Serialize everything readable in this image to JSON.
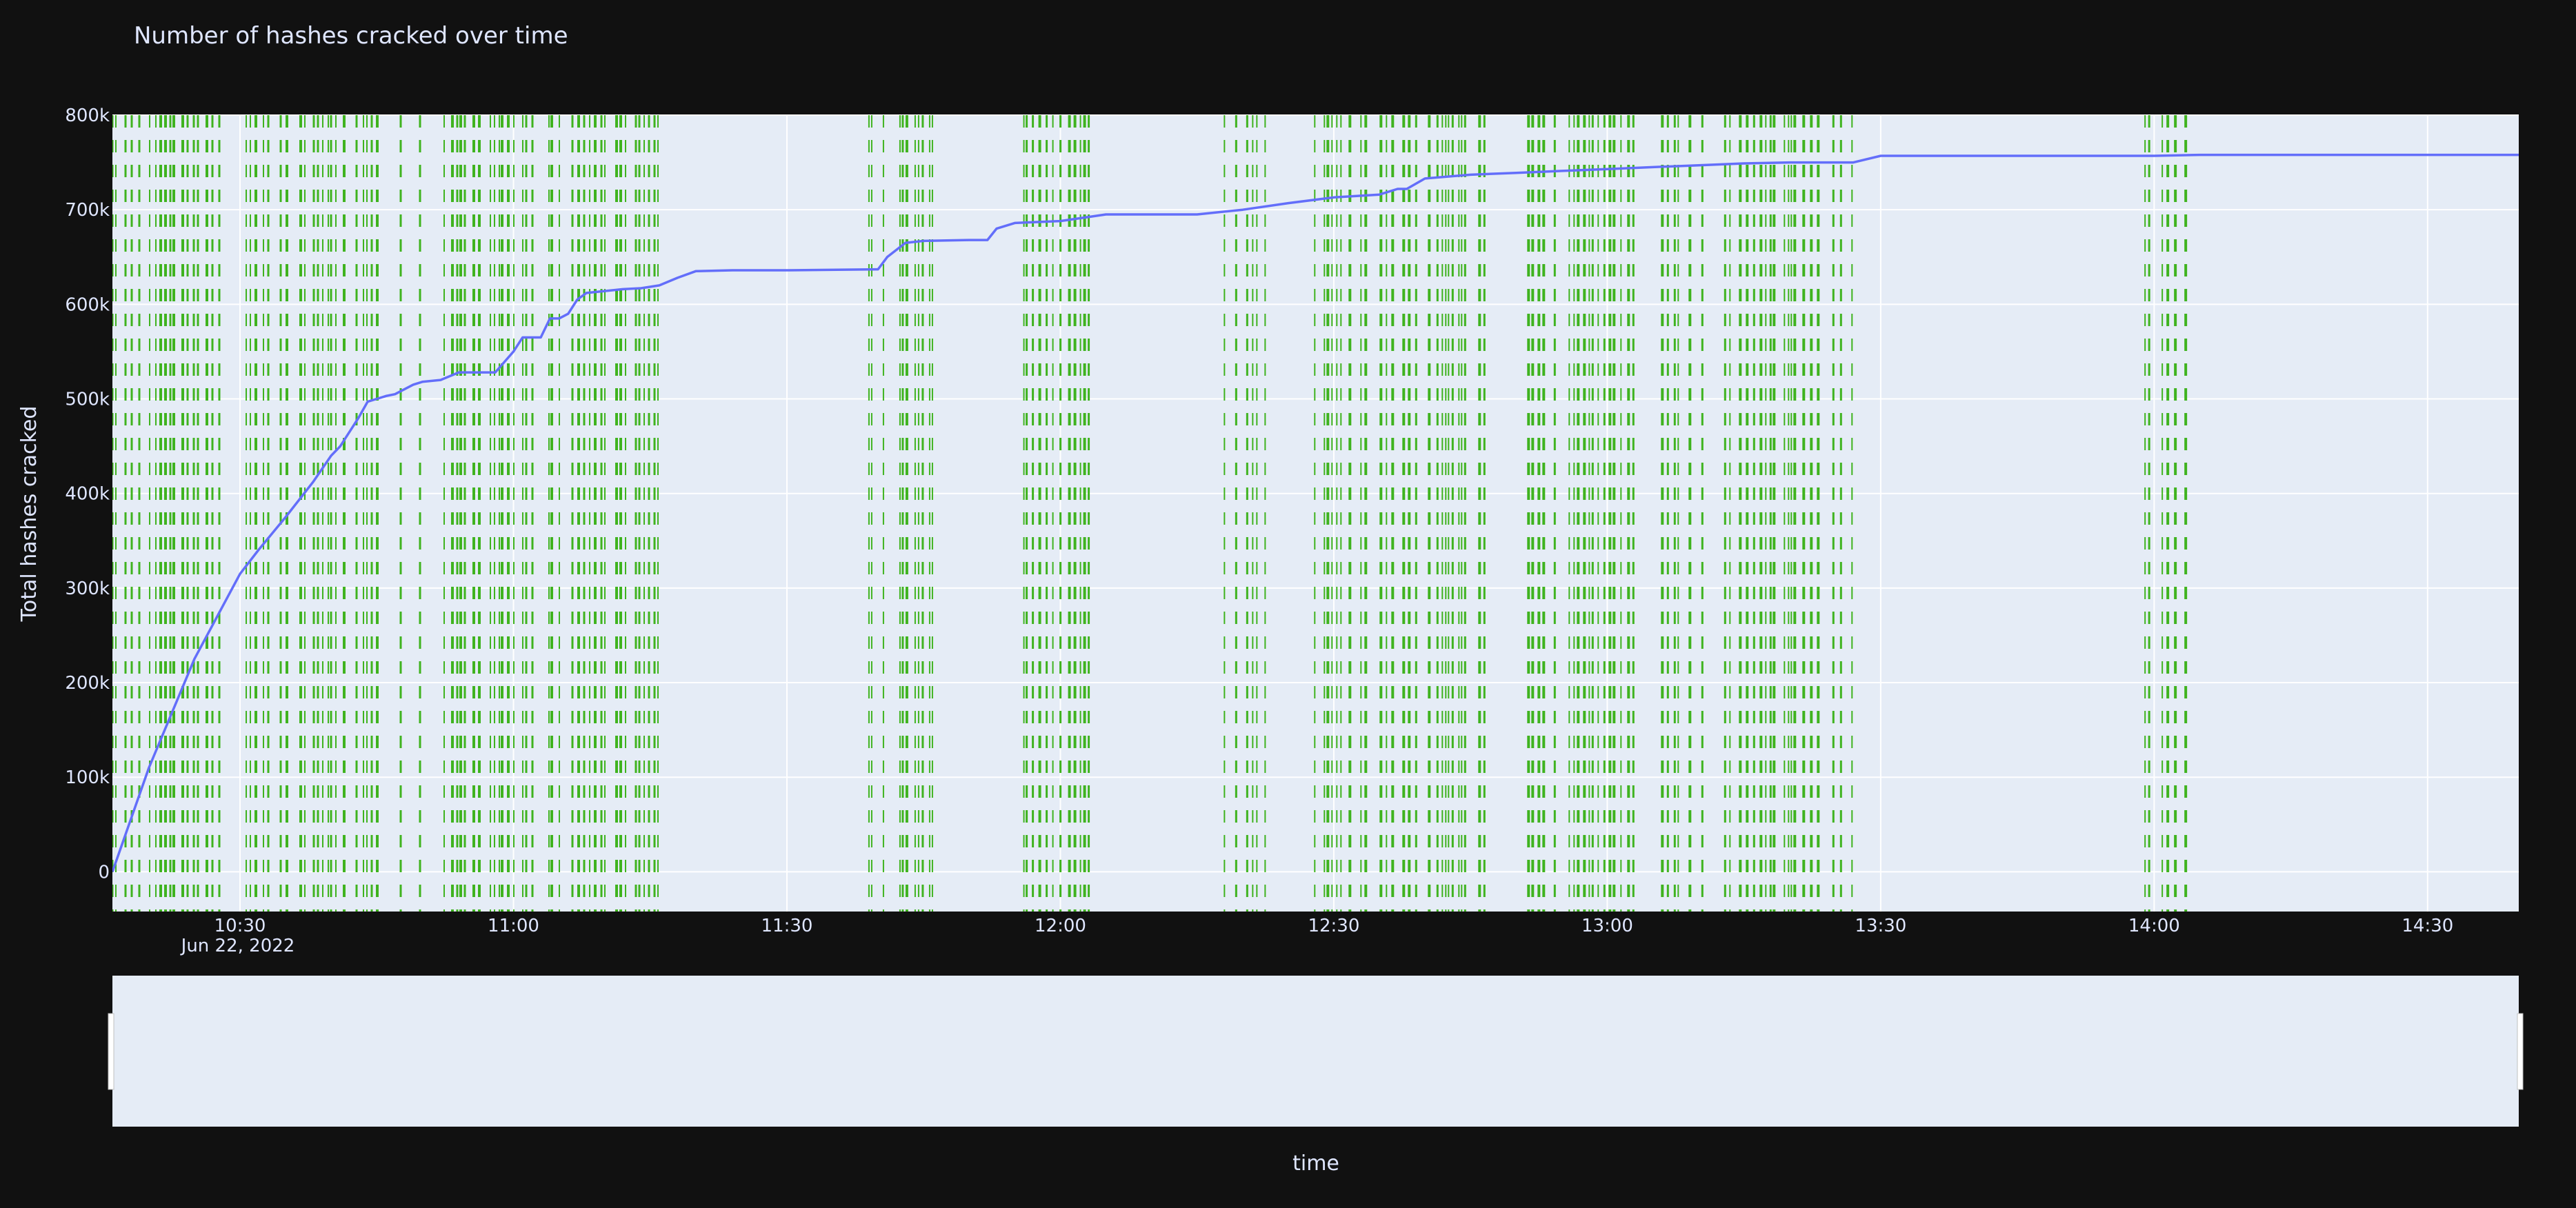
{
  "chart_data": {
    "type": "line",
    "title": "Number of hashes cracked over time",
    "xlabel": "time",
    "ylabel": "Total hashes cracked",
    "x_tick_labels": [
      "10:30",
      "11:00",
      "11:30",
      "12:00",
      "12:30",
      "13:00",
      "13:30",
      "14:00",
      "14:30"
    ],
    "x_date_label": "Jun 22, 2022",
    "y_tick_labels": [
      "0",
      "100k",
      "200k",
      "300k",
      "400k",
      "500k",
      "600k",
      "700k",
      "800k"
    ],
    "y_ticks": [
      0,
      100000,
      200000,
      300000,
      400000,
      500000,
      600000,
      700000,
      800000
    ],
    "xlim": [
      "2022-06-22 10:16",
      "2022-06-22 14:40"
    ],
    "ylim": [
      -42000,
      800000
    ],
    "grid": true,
    "rangeslider": true,
    "colors": {
      "line": "#636efa",
      "event_marks": "#3fb31f",
      "plot_bg": "#e5ecf6",
      "paper_bg": "#111111",
      "grid": "#ffffff"
    },
    "series": [
      {
        "x": [
          "10:16",
          "10:20",
          "10:25",
          "10:30",
          "10:32",
          "10:35",
          "10:38",
          "10:40",
          "10:41",
          "10:43",
          "10:44",
          "10:45",
          "10:46",
          "10:47",
          "10:48",
          "10:49",
          "10:50",
          "10:52",
          "10:54",
          "10:55",
          "10:56",
          "10:57",
          "10:58",
          "11:00",
          "11:01",
          "11:02",
          "11:03",
          "11:04",
          "11:05",
          "11:06",
          "11:07",
          "11:08",
          "11:10",
          "11:12",
          "11:14",
          "11:16",
          "11:18",
          "11:20",
          "11:24",
          "11:30",
          "11:40",
          "11:41",
          "11:43",
          "11:45",
          "11:50",
          "11:52",
          "11:53",
          "11:55",
          "12:00",
          "12:05",
          "12:15",
          "12:20",
          "12:25",
          "12:30",
          "12:35",
          "12:37",
          "12:38",
          "12:40",
          "12:45",
          "12:50",
          "12:55",
          "13:00",
          "13:05",
          "13:10",
          "13:15",
          "13:20",
          "13:27",
          "13:30",
          "13:45",
          "14:00",
          "14:05",
          "14:20",
          "14:40"
        ],
        "y": [
          0,
          110000,
          225000,
          315000,
          340000,
          375000,
          412000,
          440000,
          450000,
          480000,
          497000,
          500000,
          503000,
          505000,
          510000,
          515000,
          518000,
          520000,
          528000,
          528000,
          528000,
          528000,
          528000,
          550000,
          565000,
          565000,
          565000,
          585000,
          585000,
          590000,
          605000,
          612000,
          614000,
          616000,
          617000,
          620000,
          628000,
          635000,
          636000,
          636000,
          637000,
          650000,
          665000,
          667000,
          668000,
          668000,
          680000,
          686000,
          688000,
          695000,
          695000,
          700000,
          707000,
          713000,
          716000,
          722000,
          722000,
          733000,
          737000,
          739000,
          741000,
          743000,
          745000,
          747000,
          749000,
          750000,
          750000,
          757000,
          757000,
          757000,
          758000,
          758000,
          758000
        ]
      }
    ],
    "event_marks": {
      "clusters": [
        [
          "10:16",
          "11:16"
        ],
        [
          "11:39",
          "11:46"
        ],
        [
          "11:56",
          "12:05"
        ],
        [
          "12:18",
          "12:23"
        ],
        [
          "12:27",
          "13:27"
        ],
        [
          "13:59",
          "14:04"
        ]
      ],
      "y_range": [
        -42000,
        800000
      ]
    }
  }
}
